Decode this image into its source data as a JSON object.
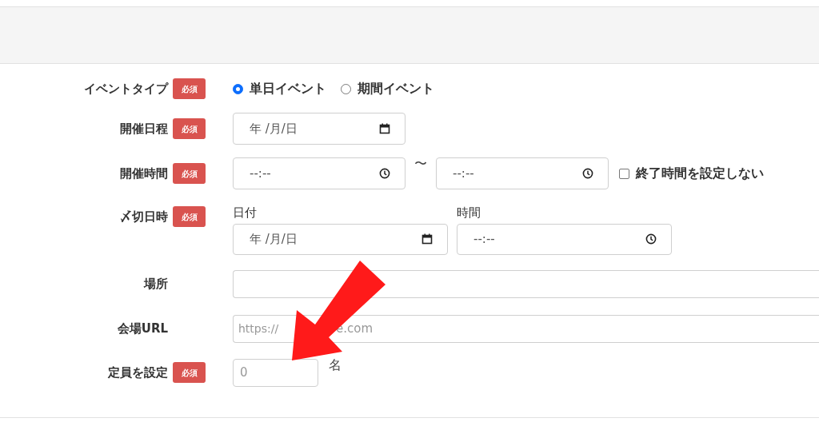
{
  "event_type": {
    "label": "イベントタイプ",
    "badge": "必須",
    "options": [
      {
        "label": "単日イベント",
        "selected": true
      },
      {
        "label": "期間イベント",
        "selected": false
      }
    ]
  },
  "schedule": {
    "label": "開催日程",
    "badge": "必須",
    "placeholder": "年 /月/日"
  },
  "time": {
    "label": "開催時間",
    "badge": "必須",
    "start_placeholder": "--:--",
    "separator": "〜",
    "end_placeholder": "--:--",
    "no_end_time": {
      "label": "終了時間を設定しない",
      "checked": false
    }
  },
  "deadline": {
    "label": "〆切日時",
    "badge": "必須",
    "date_label": "日付",
    "date_placeholder": "年 /月/日",
    "time_label": "時間",
    "time_placeholder": "--:--"
  },
  "place": {
    "label": "場所"
  },
  "venue_url": {
    "label": "会場URL",
    "placeholder_parts": [
      "https://",
      "e.com"
    ]
  },
  "capacity": {
    "label": "定員を設定",
    "badge": "必須",
    "placeholder": "0",
    "unit": "名"
  }
}
